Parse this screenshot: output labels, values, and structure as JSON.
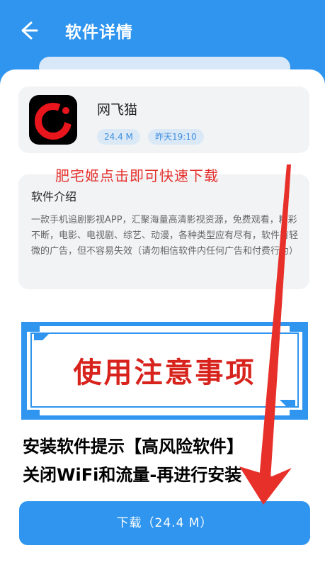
{
  "header": {
    "title": "软件详情"
  },
  "app": {
    "name": "网飞猫",
    "size": "24.4 M",
    "time": "昨天19:10"
  },
  "overlay": {
    "text": "肥宅姬点击即可快速下载"
  },
  "intro": {
    "title": "软件介绍",
    "body": "一款手机追剧影视APP，汇聚海量高清影视资源，免费观看，精彩不断，电影、电视剧、综艺、动漫，各种类型应有尽有，软件有轻微的广告，但不容易失效（请勿相信软件内任何广告和付费行为）"
  },
  "banner": {
    "title": "使用注意事项",
    "line1": "安装软件提示【高风险软件】",
    "line2": "关闭WiFi和流量-再进行安装"
  },
  "download": {
    "label": "下载（24.4 M）"
  },
  "colors": {
    "primary": "#2f95ef",
    "accent_red": "#e4322e"
  }
}
